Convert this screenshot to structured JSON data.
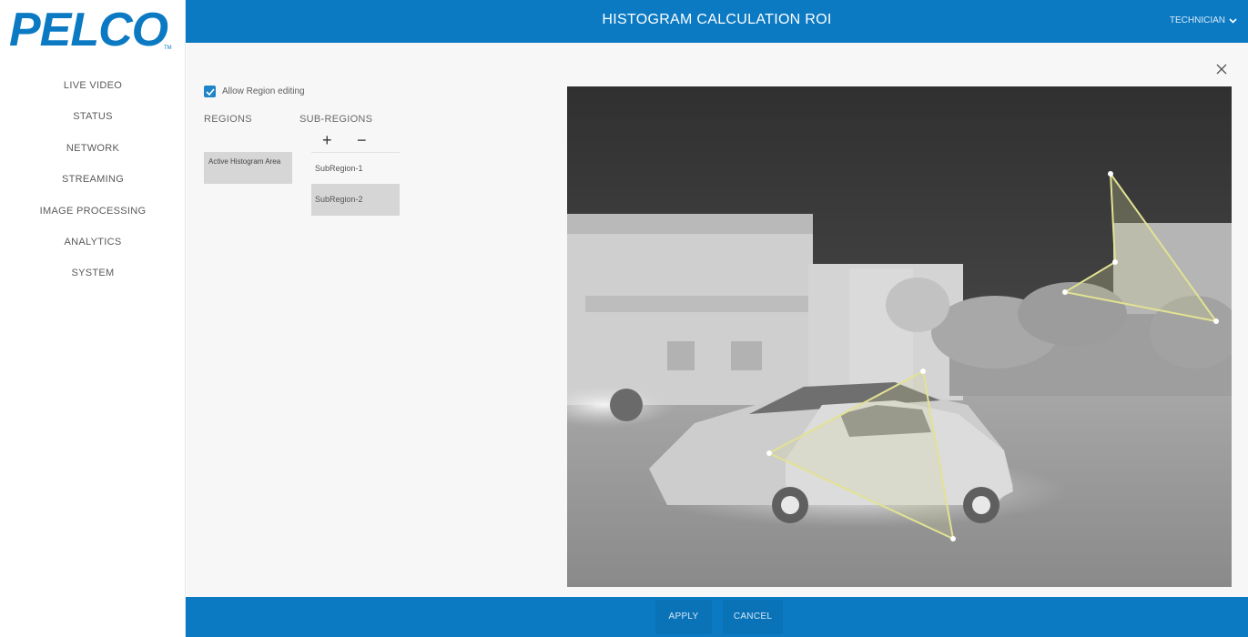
{
  "brand": {
    "logo_text": "PELCO",
    "accent": "#0b7ac3"
  },
  "sidebar": {
    "items": [
      {
        "label": "LIVE VIDEO"
      },
      {
        "label": "STATUS"
      },
      {
        "label": "NETWORK"
      },
      {
        "label": "STREAMING"
      },
      {
        "label": "IMAGE PROCESSING"
      },
      {
        "label": "ANALYTICS"
      },
      {
        "label": "SYSTEM"
      }
    ]
  },
  "header": {
    "title": "HISTOGRAM CALCULATION ROI",
    "user": "TECHNICIAN"
  },
  "panel": {
    "allow_editing": {
      "label": "Allow Region editing",
      "checked": true
    },
    "regions_title": "REGIONS",
    "subregions_title": "SUB-REGIONS",
    "plus_label": "+",
    "minus_label": "−",
    "regions": [
      {
        "label": "Active Histogram Area",
        "selected": true
      }
    ],
    "subregions": [
      {
        "label": "SubRegion-1",
        "selected": false
      },
      {
        "label": "SubRegion-2",
        "selected": true
      }
    ]
  },
  "footer": {
    "apply_label": "APPLY",
    "cancel_label": "CANCEL"
  },
  "icons": {
    "close": "close-icon",
    "check": "check-icon",
    "chevron": "chevron-down-icon"
  }
}
